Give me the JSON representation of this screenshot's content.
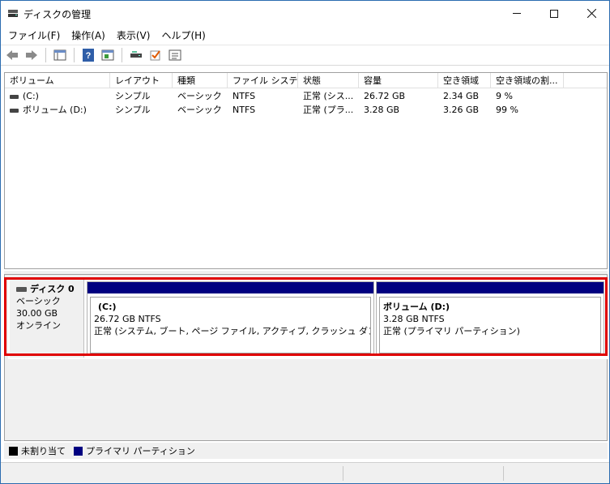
{
  "window": {
    "title": "ディスクの管理",
    "controls": {
      "minimize_icon": "minimize-icon",
      "maximize_icon": "maximize-icon",
      "close_icon": "close-icon"
    }
  },
  "menu": [
    "ファイル(F)",
    "操作(A)",
    "表示(V)",
    "ヘルプ(H)"
  ],
  "toolbar": [
    "back-icon",
    "forward-icon",
    "console-tree-icon",
    "help-icon",
    "action-pane-icon",
    "rescan-icon",
    "check-icon",
    "properties-icon"
  ],
  "columns": [
    "ボリューム",
    "レイアウト",
    "種類",
    "ファイル システム",
    "状態",
    "容量",
    "空き領域",
    "空き領域の割..."
  ],
  "volumes": [
    {
      "name": "(C:)",
      "layout": "シンプル",
      "type": "ベーシック",
      "fs": "NTFS",
      "status": "正常 (シス...",
      "capacity": "26.72 GB",
      "free": "2.34 GB",
      "free_pct": "9 %"
    },
    {
      "name": "ボリューム (D:)",
      "layout": "シンプル",
      "type": "ベーシック",
      "fs": "NTFS",
      "status": "正常 (プラ...",
      "capacity": "3.28 GB",
      "free": "3.26 GB",
      "free_pct": "99 %"
    }
  ],
  "disk": {
    "name": "ディスク 0",
    "type": "ベーシック",
    "size": "30.00 GB",
    "state": "オンライン",
    "partitions": [
      {
        "title": "(C:)",
        "size_fs": "26.72 GB NTFS",
        "status": "正常 (システム, ブート, ページ ファイル, アクティブ, クラッシュ ダンプ, プライマリ パーティション)"
      },
      {
        "title": "ボリューム (D:)",
        "size_fs": "3.28 GB NTFS",
        "status": "正常 (プライマリ パーティション)"
      }
    ]
  },
  "legend": [
    {
      "label": "未割り当て",
      "color": "#000000"
    },
    {
      "label": "プライマリ パーティション",
      "color": "#000080"
    }
  ],
  "colors": {
    "partition_band": "#000080",
    "highlight": "#e00000"
  }
}
